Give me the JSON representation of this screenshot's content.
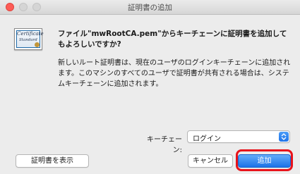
{
  "window": {
    "title": "証明書の追加"
  },
  "icon": {
    "name": "certificate-icon",
    "text": "Certificate",
    "sub": "Standard"
  },
  "message": {
    "title": "ファイル\"mwRootCA.pem\"からキーチェーンに証明書を追加してもよろしいですか?",
    "body": "新しいルート証明書は、現在のユーザのログインキーチェーンに追加されます。このマシンのすべてのユーザで証明書が共有される場合は、システムキーチェーンに追加されます。"
  },
  "keychain": {
    "label": "キーチェーン:",
    "selected": "ログイン"
  },
  "buttons": {
    "view_certificates": "証明書を表示",
    "cancel": "キャンセル",
    "add": "追加"
  },
  "colors": {
    "accent": "#1f74e8",
    "highlight": "#e8131b",
    "close": "#fd5c56"
  }
}
